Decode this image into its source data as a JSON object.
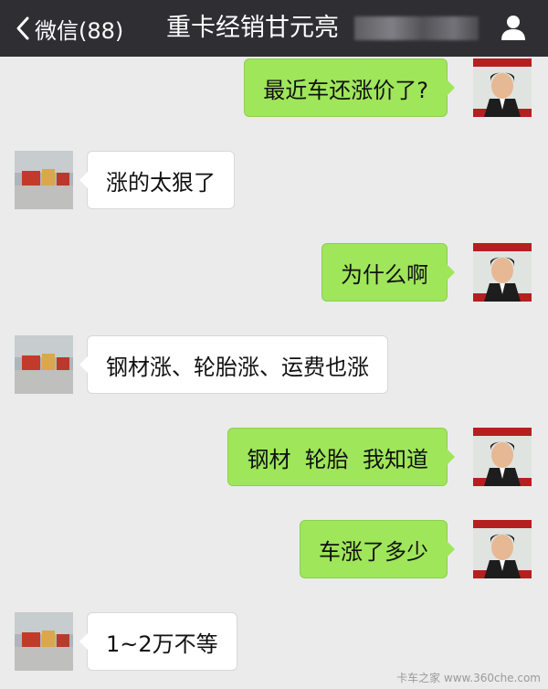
{
  "header": {
    "back_label": "微信(88)",
    "title": "重卡经销甘元亮",
    "colors": {
      "bar": "#2e2e33",
      "text": "#ffffff"
    }
  },
  "colors": {
    "background": "#ebebeb",
    "my_bubble": "#9fe65a",
    "their_bubble": "#ffffff"
  },
  "messages": [
    {
      "from": "me",
      "text": "最近车还涨价了?"
    },
    {
      "from": "them",
      "text": "涨的太狠了"
    },
    {
      "from": "me",
      "text": "为什么啊"
    },
    {
      "from": "them",
      "text": "钢材涨、轮胎涨、运费也涨"
    },
    {
      "from": "me",
      "text": "钢材  轮胎  我知道"
    },
    {
      "from": "me",
      "text": "车涨了多少"
    },
    {
      "from": "them",
      "text": "1~2万不等"
    }
  ],
  "watermark": "卡车之家 www.360che.com"
}
